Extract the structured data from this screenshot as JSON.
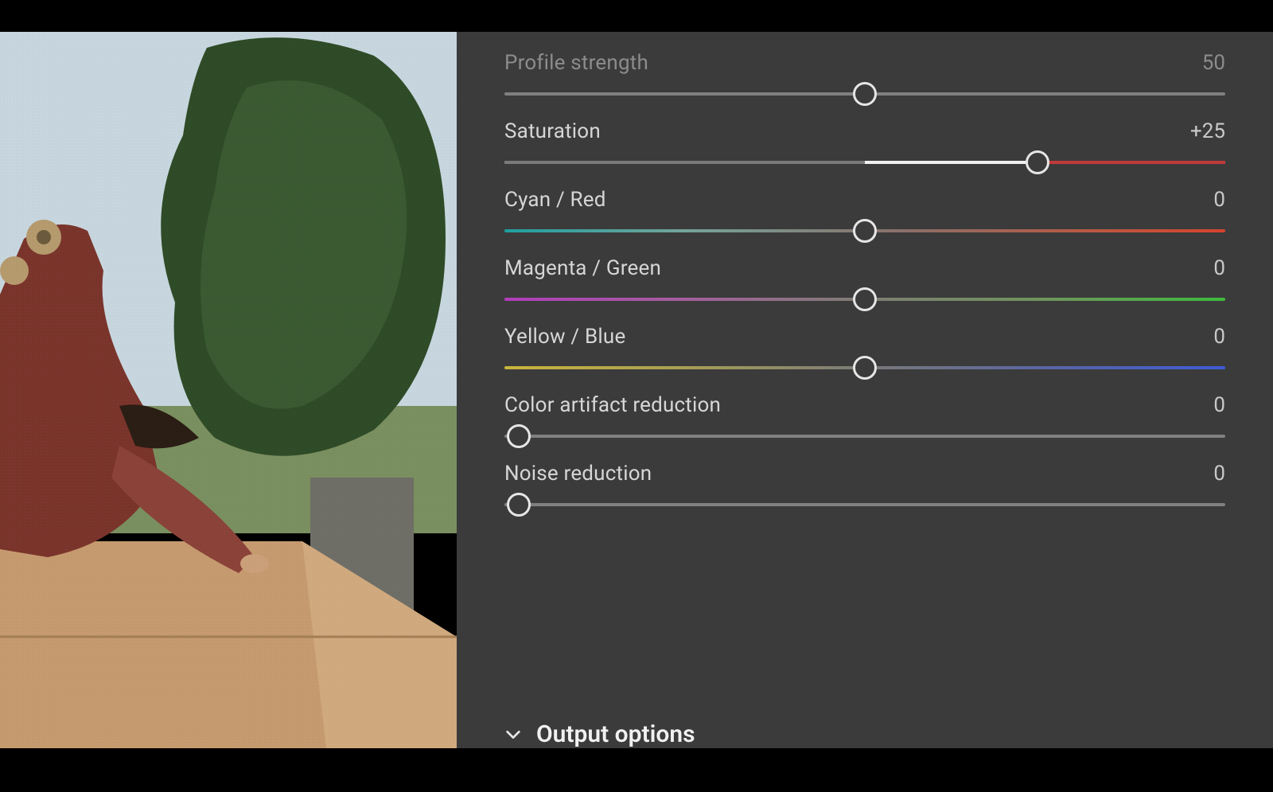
{
  "panel": {
    "sliders": {
      "profile_strength": {
        "label": "Profile strength",
        "value": "50",
        "position": 50,
        "dim": true
      },
      "saturation": {
        "label": "Saturation",
        "value": "+25",
        "position": 74
      },
      "cyan_red": {
        "label": "Cyan / Red",
        "value": "0",
        "position": 50
      },
      "magenta_green": {
        "label": "Magenta / Green",
        "value": "0",
        "position": 50
      },
      "yellow_blue": {
        "label": "Yellow / Blue",
        "value": "0",
        "position": 50
      },
      "color_artifact": {
        "label": "Color artifact reduction",
        "value": "0",
        "position": 2
      },
      "noise_reduction": {
        "label": "Noise reduction",
        "value": "0",
        "position": 2
      }
    },
    "section_header": "Output options"
  }
}
